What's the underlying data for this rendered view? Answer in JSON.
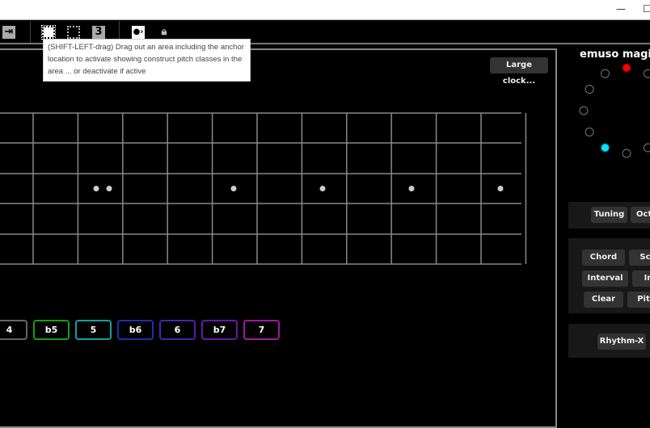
{
  "window": {
    "minimize": "—",
    "maximize": "☐"
  },
  "toolbar": {
    "icons": [
      "export-icon",
      "area-select-icon",
      "grid-select-icon",
      "number-3-icon",
      "play-next-icon",
      "lock-icon"
    ],
    "three_label": "3"
  },
  "tooltip": "(SHIFT-LEFT-drag) Drag out an area including the anchor location to activate showing construct pitch classes in the area ... or deactivate if active",
  "large_clock_button": "Large clock...",
  "fretboard": {
    "strings": 6,
    "frets": 12,
    "markers": "white-dots"
  },
  "degrees": [
    {
      "label": "4",
      "color": "#5a6a5a"
    },
    {
      "label": "b5",
      "color": "#12a012"
    },
    {
      "label": "5",
      "color": "#12a0a0"
    },
    {
      "label": "b6",
      "color": "#1a30b0"
    },
    {
      "label": "6",
      "color": "#4a20b0"
    },
    {
      "label": "b7",
      "color": "#6a18a8"
    },
    {
      "label": "7",
      "color": "#a018a0"
    }
  ],
  "side": {
    "title": "emuso magic",
    "clock": {
      "active_red": "#ff0000",
      "active_cyan": "#00e5ff"
    },
    "buttons1": [
      "Tuning",
      "Octa"
    ],
    "buttons2": [
      "Chord",
      "Sc",
      "Interval",
      "In",
      "Clear",
      "Pit"
    ],
    "buttons3": [
      "Rhythm-X"
    ]
  }
}
